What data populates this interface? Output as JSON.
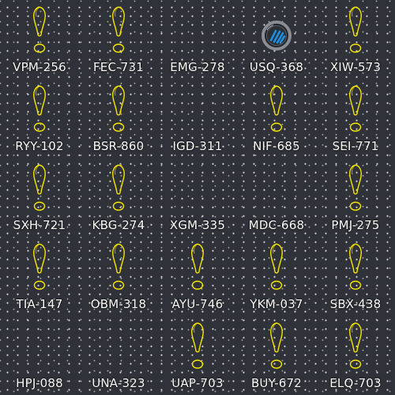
{
  "colors": {
    "background": "#2f3238",
    "marker": "#f5e400",
    "label": "#ffffff",
    "device_ring": "#8a8d92",
    "device_accent": "#1e8fe0"
  },
  "cells": [
    {
      "label": "VPM-256",
      "icon": "outline-marker-icon"
    },
    {
      "label": "FEC-731",
      "icon": "outline-marker-icon"
    },
    {
      "label": "EMG-278",
      "icon": "none"
    },
    {
      "label": "USQ-368",
      "icon": "wifi-device-icon"
    },
    {
      "label": "XIW-573",
      "icon": "outline-marker-icon"
    },
    {
      "label": "RYY-102",
      "icon": "outline-marker-icon"
    },
    {
      "label": "BSR-860",
      "icon": "outline-marker-icon"
    },
    {
      "label": "IGD-311",
      "icon": "none"
    },
    {
      "label": "NIF-685",
      "icon": "outline-marker-icon"
    },
    {
      "label": "SEI-771",
      "icon": "outline-marker-icon"
    },
    {
      "label": "SXH-721",
      "icon": "outline-marker-icon"
    },
    {
      "label": "KBG-274",
      "icon": "outline-marker-icon"
    },
    {
      "label": "XGM-335",
      "icon": "none"
    },
    {
      "label": "MDC-668",
      "icon": "none"
    },
    {
      "label": "PMJ-275",
      "icon": "outline-marker-icon"
    },
    {
      "label": "TIA-147",
      "icon": "outline-marker-icon"
    },
    {
      "label": "OBM-318",
      "icon": "outline-marker-icon"
    },
    {
      "label": "AYU-746",
      "icon": "outline-marker-icon"
    },
    {
      "label": "YKM-037",
      "icon": "outline-marker-icon"
    },
    {
      "label": "SBX-438",
      "icon": "outline-marker-icon"
    },
    {
      "label": "HPJ-088",
      "icon": "none"
    },
    {
      "label": "UNA-323",
      "icon": "none"
    },
    {
      "label": "UAP-703",
      "icon": "outline-marker-icon"
    },
    {
      "label": "BUY-672",
      "icon": "outline-marker-icon"
    },
    {
      "label": "ELQ-703",
      "icon": "outline-marker-icon"
    }
  ]
}
